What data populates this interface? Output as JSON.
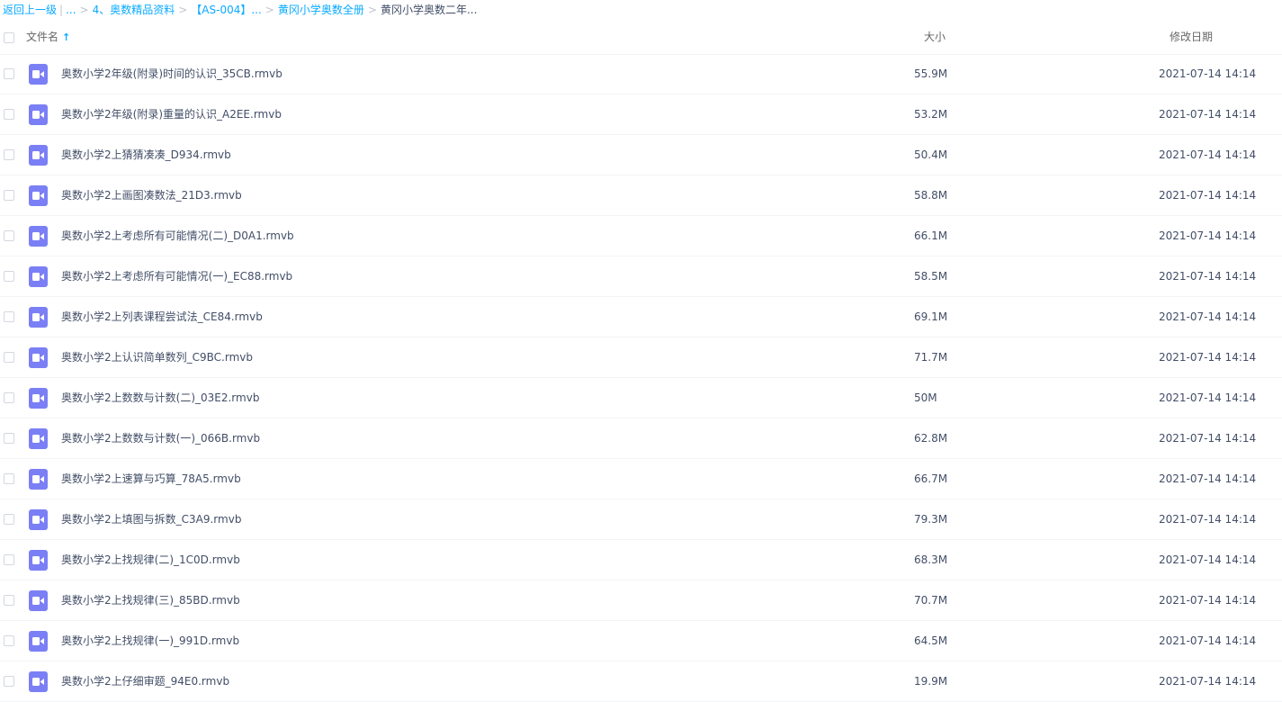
{
  "breadcrumb": {
    "back_label": "返回上一级",
    "pipe": "|",
    "ellipsis": "...",
    "sep": ">",
    "crumb1": "4、奥数精品资料",
    "crumb2": "【AS-004】...",
    "crumb3": "黄冈小学奥数全册",
    "current": "黄冈小学奥数二年..."
  },
  "header": {
    "name_label": "文件名",
    "sort_icon": "↑",
    "size_label": "大小",
    "date_label": "修改日期"
  },
  "colors": {
    "link": "#09aaff",
    "icon_bg": "#7b7ff5",
    "text": "#424e67"
  },
  "files": [
    {
      "icon": "video-file-icon",
      "name": "奥数小学2年级(附录)时间的认识_35CB.rmvb",
      "size": "55.9M",
      "date": "2021-07-14 14:14"
    },
    {
      "icon": "video-file-icon",
      "name": "奥数小学2年级(附录)重量的认识_A2EE.rmvb",
      "size": "53.2M",
      "date": "2021-07-14 14:14"
    },
    {
      "icon": "video-file-icon",
      "name": "奥数小学2上猜猜凑凑_D934.rmvb",
      "size": "50.4M",
      "date": "2021-07-14 14:14"
    },
    {
      "icon": "video-file-icon",
      "name": "奥数小学2上画图凑数法_21D3.rmvb",
      "size": "58.8M",
      "date": "2021-07-14 14:14"
    },
    {
      "icon": "video-file-icon",
      "name": "奥数小学2上考虑所有可能情况(二)_D0A1.rmvb",
      "size": "66.1M",
      "date": "2021-07-14 14:14"
    },
    {
      "icon": "video-file-icon",
      "name": "奥数小学2上考虑所有可能情况(一)_EC88.rmvb",
      "size": "58.5M",
      "date": "2021-07-14 14:14"
    },
    {
      "icon": "video-file-icon",
      "name": "奥数小学2上列表课程尝试法_CE84.rmvb",
      "size": "69.1M",
      "date": "2021-07-14 14:14"
    },
    {
      "icon": "video-file-icon",
      "name": "奥数小学2上认识简单数列_C9BC.rmvb",
      "size": "71.7M",
      "date": "2021-07-14 14:14"
    },
    {
      "icon": "video-file-icon",
      "name": "奥数小学2上数数与计数(二)_03E2.rmvb",
      "size": "50M",
      "date": "2021-07-14 14:14"
    },
    {
      "icon": "video-file-icon",
      "name": "奥数小学2上数数与计数(一)_066B.rmvb",
      "size": "62.8M",
      "date": "2021-07-14 14:14"
    },
    {
      "icon": "video-file-icon",
      "name": "奥数小学2上速算与巧算_78A5.rmvb",
      "size": "66.7M",
      "date": "2021-07-14 14:14"
    },
    {
      "icon": "video-file-icon",
      "name": "奥数小学2上填图与拆数_C3A9.rmvb",
      "size": "79.3M",
      "date": "2021-07-14 14:14"
    },
    {
      "icon": "video-file-icon",
      "name": "奥数小学2上找规律(二)_1C0D.rmvb",
      "size": "68.3M",
      "date": "2021-07-14 14:14"
    },
    {
      "icon": "video-file-icon",
      "name": "奥数小学2上找规律(三)_85BD.rmvb",
      "size": "70.7M",
      "date": "2021-07-14 14:14"
    },
    {
      "icon": "video-file-icon",
      "name": "奥数小学2上找规律(一)_991D.rmvb",
      "size": "64.5M",
      "date": "2021-07-14 14:14"
    },
    {
      "icon": "video-file-icon",
      "name": "奥数小学2上仔细审题_94E0.rmvb",
      "size": "19.9M",
      "date": "2021-07-14 14:14"
    }
  ]
}
